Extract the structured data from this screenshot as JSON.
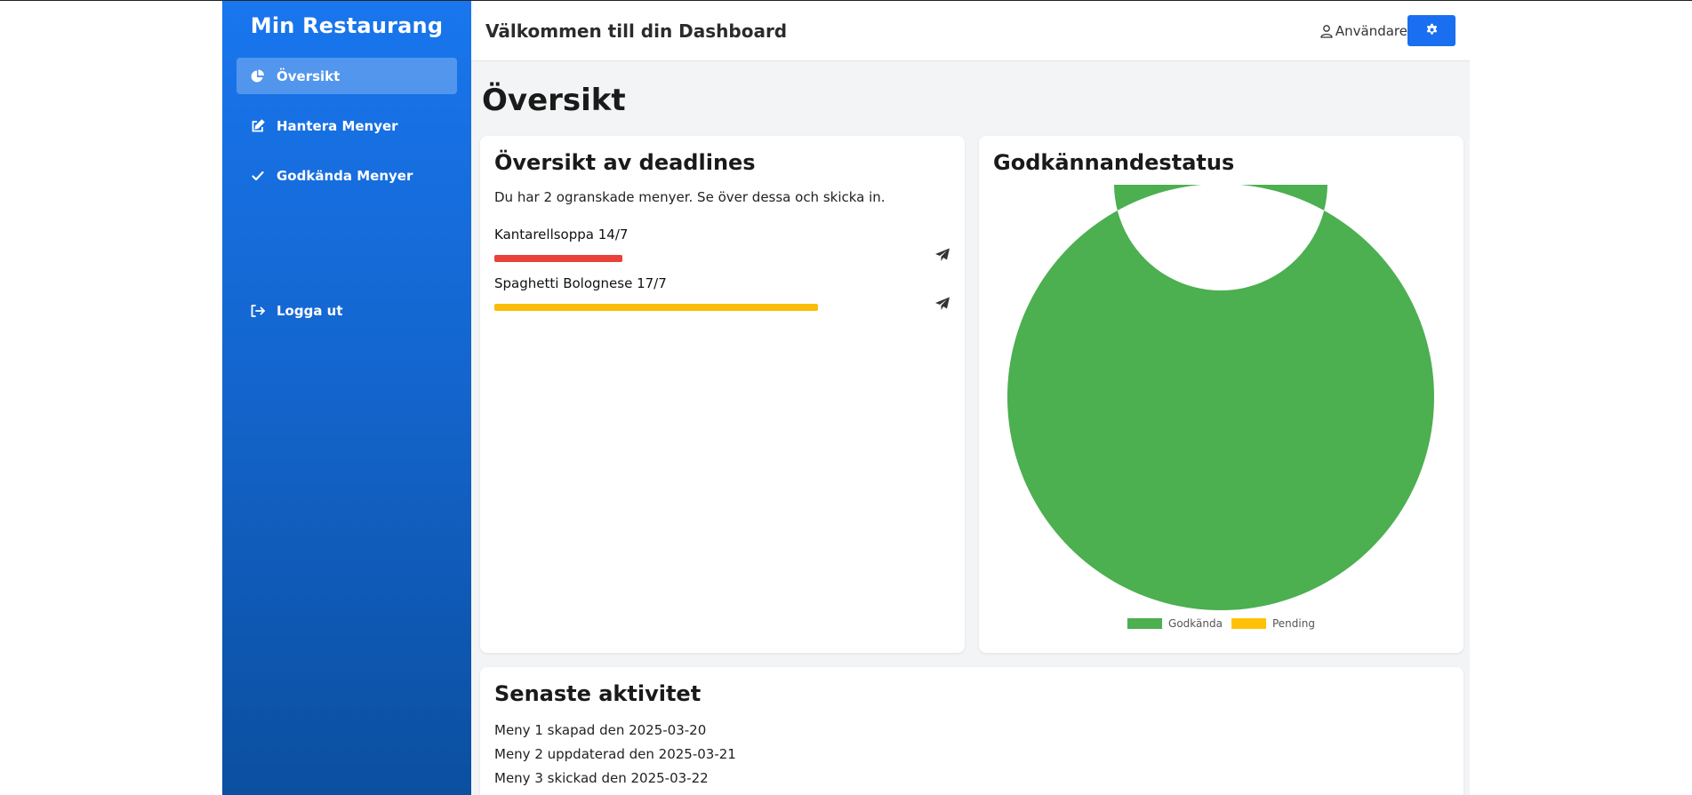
{
  "sidebar": {
    "brand": "Min Restaurang",
    "items": [
      {
        "label": "Översikt",
        "icon": "pie-chart-icon",
        "active": true
      },
      {
        "label": "Hantera Menyer",
        "icon": "edit-icon",
        "active": false
      },
      {
        "label": "Godkända Menyer",
        "icon": "check-icon",
        "active": false
      }
    ],
    "logout": {
      "label": "Logga ut",
      "icon": "logout-icon"
    }
  },
  "topbar": {
    "title": "Välkommen till din Dashboard",
    "user_label": "Användare",
    "settings_icon": "gear-icon"
  },
  "page": {
    "title": "Översikt"
  },
  "deadlines": {
    "title": "Översikt av deadlines",
    "description": "Du har 2 ogranskade menyer. Se över dessa och skicka in.",
    "items": [
      {
        "label": "Kantarellsoppa 14/7",
        "progress": 0.28,
        "color": "#e8423a"
      },
      {
        "label": "Spaghetti Bolognese 17/7",
        "progress": 0.71,
        "color": "#fbbd08"
      }
    ]
  },
  "status": {
    "title": "Godkännandestatus"
  },
  "chart_data": {
    "type": "pie",
    "donut": true,
    "categories": [
      "Godkända",
      "Pending"
    ],
    "values": [
      100,
      0
    ],
    "colors": [
      "#4caf50",
      "#ffc107"
    ],
    "legend": "bottom"
  },
  "activity": {
    "title": "Senaste aktivitet",
    "items": [
      "Meny 1 skapad den 2025-03-20",
      "Meny 2 uppdaterad den 2025-03-21",
      "Meny 3 skickad den 2025-03-22"
    ]
  }
}
